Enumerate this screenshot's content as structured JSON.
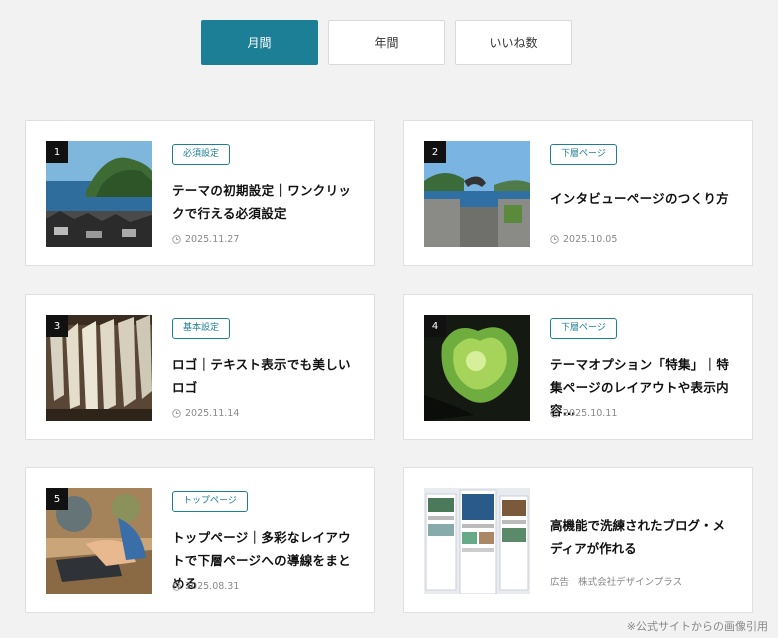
{
  "tabs": [
    {
      "label": "月間",
      "active": true
    },
    {
      "label": "年間",
      "active": false
    },
    {
      "label": "いいね数",
      "active": false
    }
  ],
  "articles": [
    {
      "rank": "1",
      "tag": "必須設定",
      "title": "テーマの初期設定｜ワンクリックで行える必須設定",
      "date": "2025.11.27",
      "image": "coastal-village-photo"
    },
    {
      "rank": "2",
      "tag": "下層ページ",
      "title": "インタビューページのつくり方",
      "date": "2025.10.05",
      "image": "pier-cat-photo"
    },
    {
      "rank": "3",
      "tag": "基本設定",
      "title": "ロゴ｜テキスト表示でも美しいロゴ",
      "date": "2025.11.14",
      "image": "hanging-radishes-photo"
    },
    {
      "rank": "4",
      "tag": "下層ページ",
      "title": "テーマオプション「特集」｜特集ページのレイアウトや表示内容…",
      "date": "2025.10.11",
      "image": "cave-canopy-photo"
    },
    {
      "rank": "5",
      "tag": "トップページ",
      "title": "トップページ｜多彩なレイアウトで下層ページへの導線をまとめる",
      "date": "2025.08.31",
      "image": "laptop-typing-photo"
    }
  ],
  "ad": {
    "title": "高機能で洗練されたブログ・メディアが作れる",
    "label": "広告",
    "sponsor": "株式会社デザインプラス",
    "image": "website-screenshots"
  },
  "credit": "※公式サイトからの画像引用",
  "colors": {
    "accent": "#1d7f96",
    "background": "#f2f2f2"
  },
  "icons": {
    "date": "clock-icon"
  }
}
